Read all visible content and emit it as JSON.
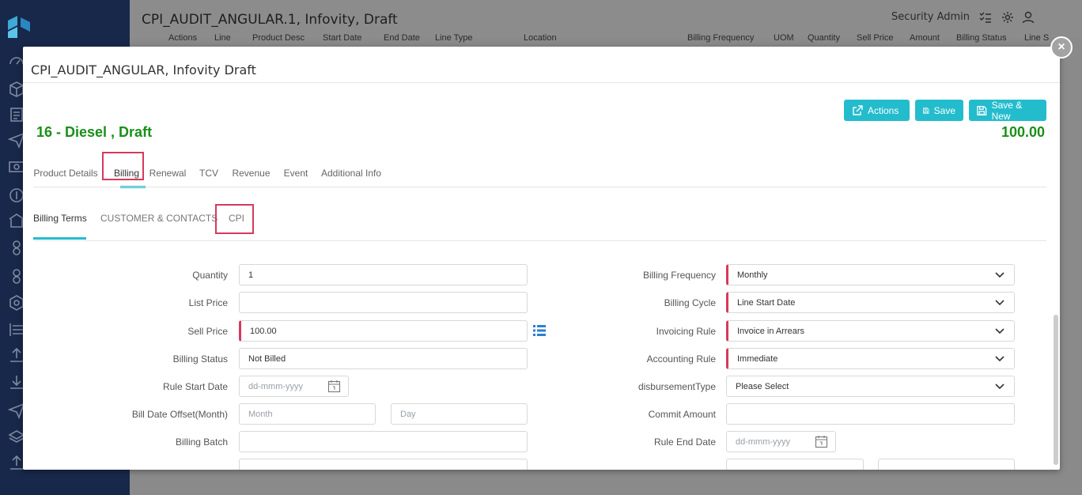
{
  "app": {
    "window_title": "CPI_AUDIT_ANGULAR.1, Infovity, Draft",
    "user_name": "Security Admin",
    "background_columns": [
      "Actions",
      "Line",
      "Product Desc",
      "Start Date",
      "End Date",
      "Line Type",
      "Location",
      "Billing Frequency",
      "UOM",
      "Quantity",
      "Sell Price",
      "Amount",
      "Billing Status",
      "Line S"
    ]
  },
  "modal": {
    "title": "CPI_AUDIT_ANGULAR, Infovity  Draft",
    "close_label": "×",
    "buttons": {
      "actions": "Actions",
      "save": "Save",
      "save_new": "Save & New"
    },
    "record_title": "16 - Diesel , Draft",
    "record_amount": "100.00"
  },
  "tabs": [
    "Product Details",
    "Billing",
    "Renewal",
    "TCV",
    "Revenue",
    "Event",
    "Additional Info"
  ],
  "active_tab": "Billing",
  "subtabs": [
    "Billing Terms",
    "CUSTOMER & CONTACTS",
    "CPI"
  ],
  "active_subtab": "Billing Terms",
  "form": {
    "quantity": {
      "label": "Quantity",
      "value": "1"
    },
    "list_price": {
      "label": "List Price",
      "value": ""
    },
    "sell_price": {
      "label": "Sell Price",
      "value": "100.00"
    },
    "billing_status": {
      "label": "Billing Status",
      "value": "Not Billed"
    },
    "rule_start_date": {
      "label": "Rule Start Date",
      "placeholder": "dd-mmm-yyyy"
    },
    "bill_date_offset": {
      "label": "Bill Date Offset(Month)",
      "month_placeholder": "Month",
      "day_placeholder": "Day"
    },
    "billing_batch": {
      "label": "Billing Batch",
      "value": ""
    },
    "billing_frequency": {
      "label": "Billing Frequency",
      "value": "Monthly"
    },
    "billing_cycle": {
      "label": "Billing Cycle",
      "value": "Line Start Date"
    },
    "invoicing_rule": {
      "label": "Invoicing Rule",
      "value": "Invoice in Arrears"
    },
    "accounting_rule": {
      "label": "Accounting Rule",
      "value": "Immediate"
    },
    "disbursement_type": {
      "label": "disbursementType",
      "value": "Please Select"
    },
    "commit_amount": {
      "label": "Commit Amount",
      "value": ""
    },
    "rule_end_date": {
      "label": "Rule End Date",
      "placeholder": "dd-mmm-yyyy"
    }
  },
  "colors": {
    "accent": "#23bccd",
    "title_green": "#189018",
    "required": "#d63a5c",
    "sidebar": "#17284a"
  }
}
